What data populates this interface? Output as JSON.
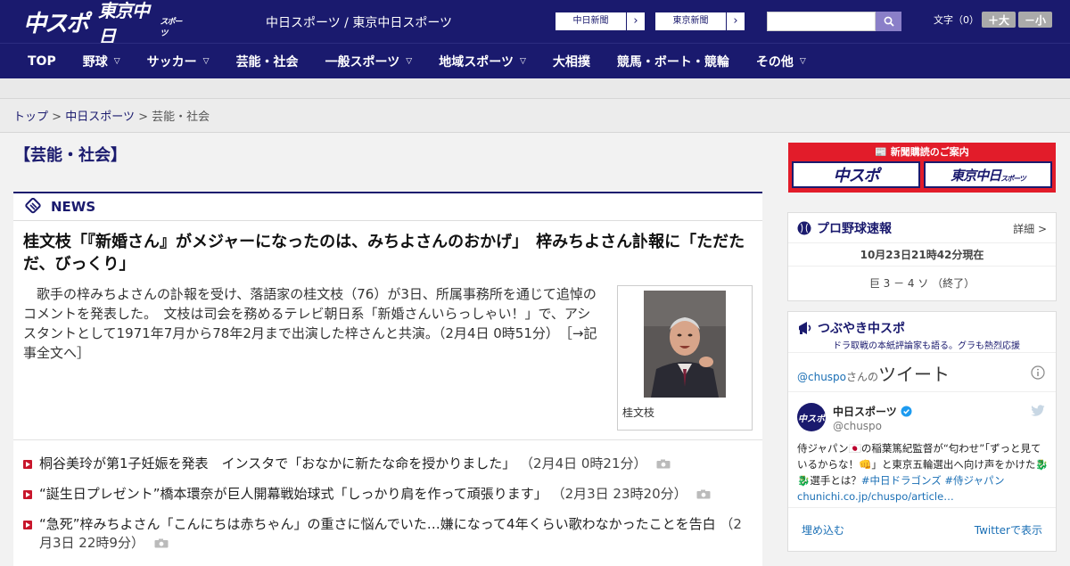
{
  "header": {
    "logo_main": "中スポ",
    "logo_tokyo": "東京中日",
    "logo_tokyo_sub": "スポーツ",
    "site_title": "中日スポーツ / 東京中日スポーツ",
    "paper_buttons": [
      {
        "label": "中日新聞",
        "arrow": "›"
      },
      {
        "label": "東京新聞",
        "arrow": "›"
      }
    ],
    "search_placeholder": "",
    "font_size_label": "文字（0）",
    "font_bigger": "＋大",
    "font_smaller": "－小",
    "icons": {
      "search": "search-icon"
    }
  },
  "nav": [
    {
      "label": "TOP",
      "dropdown": false
    },
    {
      "label": "野球",
      "dropdown": true
    },
    {
      "label": "サッカー",
      "dropdown": true
    },
    {
      "label": "芸能・社会",
      "dropdown": false
    },
    {
      "label": "一般スポーツ",
      "dropdown": true
    },
    {
      "label": "地域スポーツ",
      "dropdown": true
    },
    {
      "label": "大相撲",
      "dropdown": false
    },
    {
      "label": "競馬・ボート・競輪",
      "dropdown": false
    },
    {
      "label": "その他",
      "dropdown": true
    }
  ],
  "breadcrumb": {
    "items": [
      "トップ",
      "中日スポーツ",
      "芸能・社会"
    ],
    "separator": ">"
  },
  "page": {
    "heading": "【芸能・社会】",
    "news_label": "NEWS"
  },
  "main_article": {
    "title": "桂文枝「『新婚さん』がメジャーになったのは、みちよさんのおかげ」　梓みちよさん訃報に「ただただ、びっくり」",
    "body": "歌手の梓みちよさんの訃報を受け、落語家の桂文枝（76）が3日、所属事務所を通じて追悼のコメントを発表した。　文枝は司会を務めるテレビ朝日系「新婚さんいらっしゃい！」で、アシスタントとして1971年7月から78年2月まで出演した梓さんと共演。（2月4日 0時51分）",
    "read_more": "［→記事全文へ］",
    "photo_caption": "桂文枝"
  },
  "news_list": [
    {
      "title": "桐谷美玲が第1子妊娠を発表　インスタで「おなかに新たな命を授かりました」",
      "date": "（2月4日 0時21分）",
      "has_photo": true
    },
    {
      "title": "“誕生日プレゼント”橋本環奈が巨人開幕戦始球式「しっかり肩を作って頑張ります」",
      "date": "（2月3日 23時20分）",
      "has_photo": true
    },
    {
      "title": "“急死”梓みちよさん「こんにちは赤ちゃん」の重さに悩んでいた…嫌になって4年くらい歌わなかったことを告白",
      "date": "（2月3日 22時9分）",
      "has_photo": true
    }
  ],
  "sidebar": {
    "subscribe": {
      "title": "新聞購読のご案内",
      "logo_left": "中スポ",
      "logo_right": "東京中日",
      "logo_right_sub": "スポーツ"
    },
    "baseball": {
      "title": "プロ野球速報",
      "detail": "詳細 >",
      "timestamp": "10月23日21時42分現在",
      "score": "巨 3 － 4 ソ （終了）"
    },
    "twitter": {
      "title": "つぶやき中スポ",
      "subtitle": "ドラ取戦の本紙評論家も語る。グラも熱烈応援",
      "handle_prefix": "@chuspo",
      "handle_suffix": "さんの",
      "tweets_label": "ツイート",
      "account_name": "中日スポーツ",
      "account_handle": "@chuspo",
      "tweet_text": "侍ジャパン🇯🇵の稲葉篤紀監督が“匂わせ”「ずっと見ているからな！👊」と東京五輪選出へ向け声をかけた🐉🐉選手とは？",
      "tweet_tags": "#中日ドラゴンズ #侍ジャパン chunichi.co.jp/chuspo/article…",
      "embed": "埋め込む",
      "view_on_twitter": "Twitterで表示"
    }
  },
  "colors": {
    "brand_navy": "#1a1a6e",
    "accent_red": "#c8162b",
    "search_purple": "#8a7fc8"
  }
}
